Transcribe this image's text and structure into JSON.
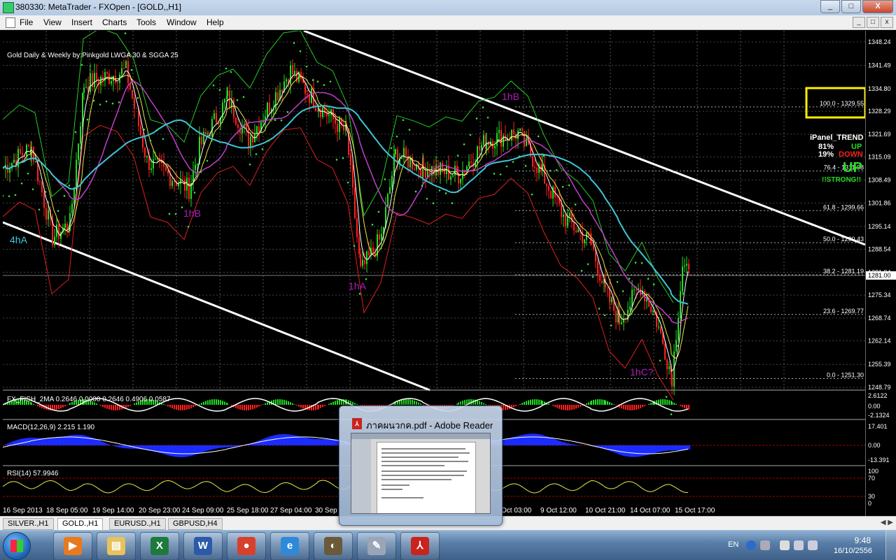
{
  "window": {
    "title": "380330: MetaTrader - FXOpen - [GOLD,,H1]",
    "controls": [
      "_",
      "□",
      "X"
    ]
  },
  "menu": {
    "items": [
      "File",
      "View",
      "Insert",
      "Charts",
      "Tools",
      "Window",
      "Help"
    ],
    "mdi_controls": [
      "_",
      "□",
      "x"
    ]
  },
  "chart": {
    "header": "Gold Daily & Weekly  by:Pinkgold  LWGA 30  &  SGGA 25",
    "current_price": "1281.00",
    "price_axis": [
      "1348.24",
      "1341.49",
      "1334.80",
      "1328.29",
      "1321.69",
      "1315.09",
      "1308.49",
      "1301.86",
      "1295.14",
      "1288.54",
      "1281.94",
      "1275.34",
      "1268.74",
      "1262.14",
      "1255.39",
      "1248.79"
    ],
    "fib_levels": [
      {
        "label": "100.0 - 1329.55",
        "price": 1329.55
      },
      {
        "label": "76.4 - 1311.08",
        "price": 1311.08
      },
      {
        "label": "61.8 - 1299.66",
        "price": 1299.66
      },
      {
        "label": "50.0 - 1290.43",
        "price": 1290.43
      },
      {
        "label": "38.2 - 1281.19",
        "price": 1281.19
      },
      {
        "label": "23.6 - 1269.77",
        "price": 1269.77
      },
      {
        "label": "0.0 - 1251.30",
        "price": 1251.3
      }
    ],
    "wave_labels": [
      {
        "text": "4hA",
        "color": "#3ec6d8"
      },
      {
        "text": "1hB",
        "color": "#b01cb8"
      },
      {
        "text": "1hA",
        "color": "#b01cb8"
      },
      {
        "text": "1hB",
        "color": "#b01cb8"
      },
      {
        "text": "1hC?",
        "color": "#b01cb8"
      }
    ],
    "ipanel": {
      "title": "iPanel_TREND",
      "up_pct": "81%",
      "up_label": "UP",
      "down_pct": "19%",
      "down_label": "DOWN",
      "trend": "UP",
      "strength": "!!STRONG!!",
      "colors": {
        "up": "#22dd22",
        "down": "#ff2020",
        "title": "#ffffff"
      }
    },
    "time_axis": [
      "16 Sep 2013",
      "18 Sep 05:00",
      "19 Sep 14:00",
      "20 Sep 23:00",
      "24 Sep 09:00",
      "25 Sep 18:00",
      "27 Sep 04:00",
      "30 Sep",
      "Oct 03:00",
      "9 Oct 12:00",
      "10 Oct 21:00",
      "14 Oct 07:00",
      "15 Oct 17:00"
    ]
  },
  "indicators": {
    "fisher": {
      "label": "FX_FISH_2MA 0.2646 0.0000 0.2646 0.4906 0.0587",
      "axis": [
        "2.6122",
        "0.00",
        "-2.1324"
      ]
    },
    "macd": {
      "label": "MACD(12,26,9) 2.215 1.190",
      "axis": [
        "17.401",
        "0.00",
        "-13.391"
      ]
    },
    "rsi": {
      "label": "RSI(14) 57.9946",
      "axis": [
        "100",
        "70",
        "30",
        "0"
      ]
    }
  },
  "tabs": [
    {
      "label": "SILVER.,H1",
      "active": false
    },
    {
      "label": "GOLD.,H1",
      "active": true
    },
    {
      "label": "EURUSD.,H1",
      "active": false
    },
    {
      "label": "GBPUSD,H4",
      "active": false
    }
  ],
  "popup": {
    "title": "ภาคผนวกค.pdf - Adobe Reader",
    "icon": "pdf-icon"
  },
  "taskbar": {
    "apps": [
      {
        "name": "media-player-icon",
        "color": "#e87a1e",
        "glyph": "▶"
      },
      {
        "name": "file-explorer-icon",
        "color": "#e8c25a",
        "glyph": "▤"
      },
      {
        "name": "excel-icon",
        "color": "#1d7a3c",
        "glyph": "X"
      },
      {
        "name": "word-icon",
        "color": "#2a5aa8",
        "glyph": "W"
      },
      {
        "name": "chrome-icon",
        "color": "#d8402e",
        "glyph": "●"
      },
      {
        "name": "internet-explorer-icon",
        "color": "#2e8ad8",
        "glyph": "e"
      },
      {
        "name": "metatrader-icon",
        "color": "#6a5a3a",
        "glyph": "◐"
      },
      {
        "name": "paint-icon",
        "color": "#9aa6b8",
        "glyph": "✎"
      },
      {
        "name": "adobe-reader-icon",
        "color": "#c8241e",
        "glyph": "⅄"
      }
    ],
    "language": "EN",
    "time": "9:48",
    "date": "16/10/2556"
  }
}
